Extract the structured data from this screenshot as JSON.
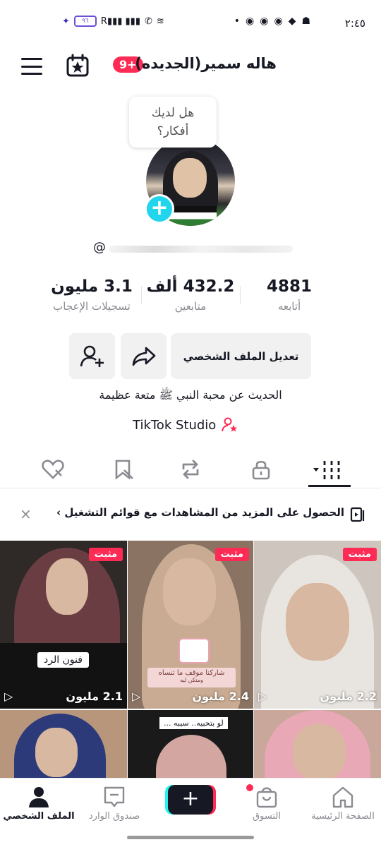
{
  "status_bar": {
    "time": "٢:٤٥",
    "battery": "٩٦"
  },
  "header": {
    "username": "هاله سمير(الجديده)",
    "notif_count": "9+"
  },
  "avatar": {
    "bubble_text_line1": "هل لديك",
    "bubble_text_line2": "أفكار؟",
    "handle_prefix": "@"
  },
  "stats": [
    {
      "value": "4881",
      "label": "أتابعه"
    },
    {
      "value": "432.2 ألف",
      "label": "متابعين"
    },
    {
      "value": "3.1 مليون",
      "label": "تسجيلات الإعجاب"
    }
  ],
  "buttons": {
    "edit_profile": "تعديل الملف الشخصي"
  },
  "bio": "الحديث عن محبة النبي ﷺ متعة عظيمة",
  "studio_label": "TikTok Studio",
  "banner": {
    "text": "الحصول على المزيد من المشاهدات مع قوائم التشغيل ›",
    "close": "×"
  },
  "videos": [
    {
      "pinned": "مثبت",
      "views": "2.2 مليون"
    },
    {
      "pinned": "مثبت",
      "views": "2.4 مليون",
      "caption": "شاركنا موقف ما تنساه",
      "sub": "ومتكن ليه"
    },
    {
      "pinned": "مثبت",
      "views": "2.1 مليون",
      "caption": "فنون الرد"
    },
    {
      "caption": ""
    },
    {
      "caption": "لو بتحبيه.. سيبه ..."
    },
    {
      "caption": ""
    }
  ],
  "bottom_nav": {
    "home": "الصفحة الرئيسية",
    "shop": "التسوق",
    "create": "+",
    "inbox": "صندوق الوارد",
    "profile": "الملف الشخصي"
  },
  "colors": {
    "accent": "#fe2c55",
    "cyan": "#20d5ec"
  }
}
